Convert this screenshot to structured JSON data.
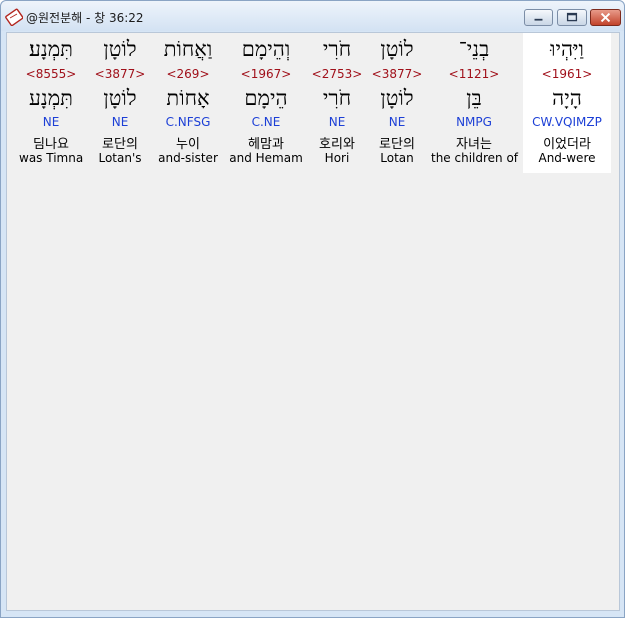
{
  "window": {
    "title": "@원전분해 - 창 36:22",
    "icon": "bible-app-icon"
  },
  "words": [
    {
      "hebrew": "תִּמְנָע׃",
      "strong": "<8555>",
      "lemma": "תִּמְנָע",
      "morph": "NE",
      "korean": "딤나요",
      "english": "was Timna"
    },
    {
      "hebrew": "לוֹטָן",
      "strong": "<3877>",
      "lemma": "לוֹטָן",
      "morph": "NE",
      "korean": "로단의",
      "english": "Lotan's"
    },
    {
      "hebrew": "וַאֲחוֹת",
      "strong": "<269>",
      "lemma": "אָחוֹת",
      "morph": "C.NFSG",
      "korean": "누이",
      "english": "and-sister"
    },
    {
      "hebrew": "וְהֵימָם",
      "strong": "<1967>",
      "lemma": "הֵימָם",
      "morph": "C.NE",
      "korean": "헤맘과",
      "english": "and Hemam"
    },
    {
      "hebrew": "חֹרִי",
      "strong": "<2753>",
      "lemma": "חֹרִי",
      "morph": "NE",
      "korean": "호리와",
      "english": "Hori"
    },
    {
      "hebrew": "לוֹטָן",
      "strong": "<3877>",
      "lemma": "לוֹטָן",
      "morph": "NE",
      "korean": "로단의",
      "english": "Lotan"
    },
    {
      "hebrew": "בְנֵי־",
      "strong": "<1121>",
      "lemma": "בֵּן",
      "morph": "NMPG",
      "korean": "자녀는",
      "english": "the children of"
    },
    {
      "hebrew": "וַיִּהְיוּ",
      "strong": "<1961>",
      "lemma": "הָיָה",
      "morph": "CW.VQIMZP",
      "korean": "이었더라",
      "english": "And-were",
      "selected": true
    }
  ]
}
